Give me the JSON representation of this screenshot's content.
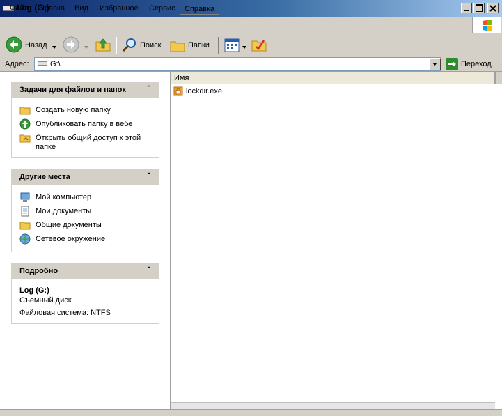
{
  "window": {
    "title": "Log (G:)"
  },
  "menu": {
    "items": [
      "Файл",
      "Правка",
      "Вид",
      "Избранное",
      "Сервис",
      "Справка"
    ]
  },
  "toolbar": {
    "back_label": "Назад",
    "search_label": "Поиск",
    "folders_label": "Папки",
    "go_label": "Переход",
    "icons": [
      "back-arrow-icon",
      "forward-arrow-icon",
      "up-folder-icon",
      "search-icon",
      "folders-icon",
      "views-icon",
      "sync-folder-icon"
    ]
  },
  "address": {
    "label": "Адрес:",
    "value": "G:\\"
  },
  "tasks_panel": {
    "title": "Задачи для файлов и папок",
    "items": [
      {
        "label": "Создать новую папку",
        "icon": "new-folder-icon"
      },
      {
        "label": "Опубликовать папку в вебе",
        "icon": "publish-web-icon"
      },
      {
        "label_line1": "Открыть общий доступ к этой",
        "label_line2": "папке",
        "icon": "share-folder-icon"
      }
    ]
  },
  "places_panel": {
    "title": "Другие места",
    "items": [
      {
        "label": "Мой компьютер",
        "icon": "my-computer-icon"
      },
      {
        "label": "Мои документы",
        "icon": "my-documents-icon"
      },
      {
        "label": "Общие документы",
        "icon": "shared-documents-icon"
      },
      {
        "label": "Сетевое окружение",
        "icon": "network-places-icon"
      }
    ]
  },
  "details_panel": {
    "title": "Подробно",
    "name": "Log (G:)",
    "type": "Съемный диск",
    "filesystem": "Файловая система: NTFS"
  },
  "file_list": {
    "column_name": "Имя",
    "files": [
      {
        "name": "lockdir.exe",
        "icon": "exe-file-icon"
      }
    ]
  },
  "colors": {
    "title_bar_start": "#0a246a",
    "title_bar_end": "#a6caf0",
    "chrome": "#d4d0c8"
  }
}
